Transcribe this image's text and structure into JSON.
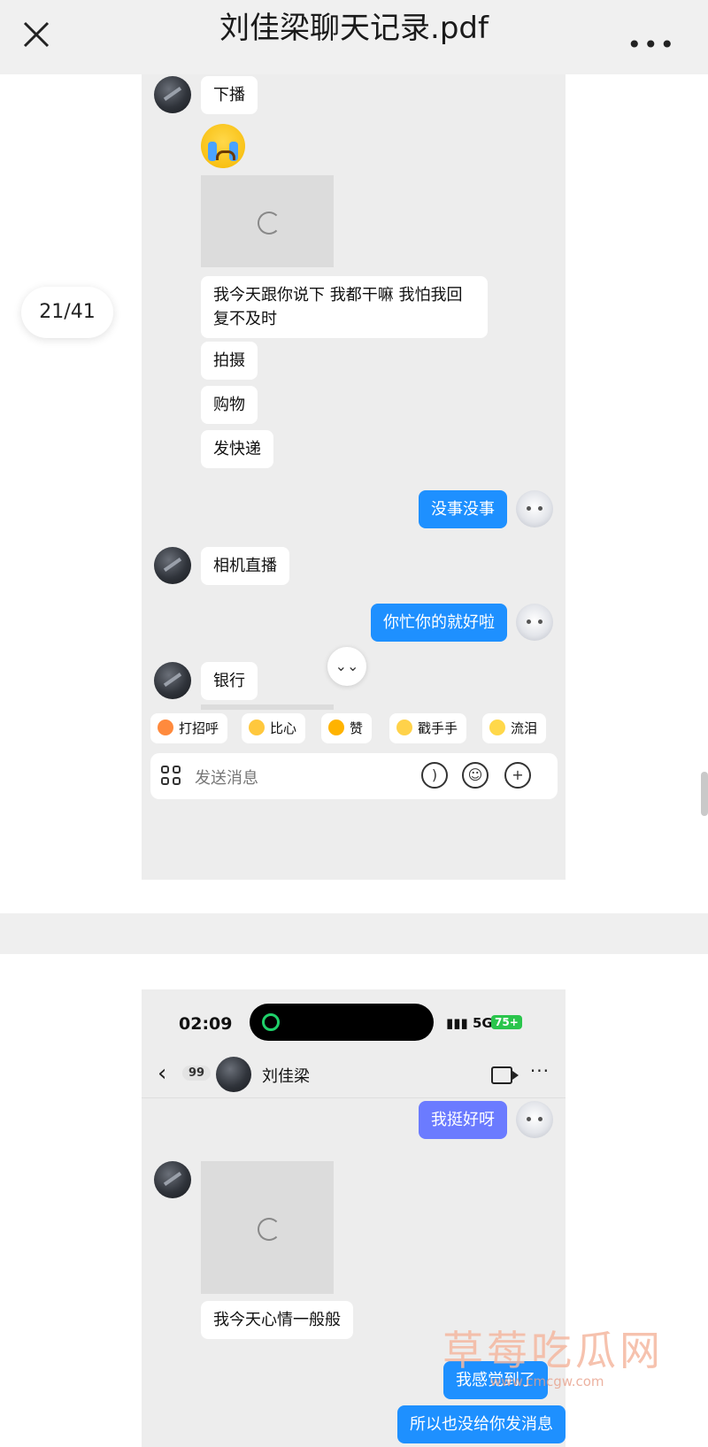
{
  "header": {
    "title": "刘佳梁聊天记录.pdf",
    "more": "•••"
  },
  "page_indicator": "21/41",
  "screenshot1": {
    "messages_left_top": [
      "下播"
    ],
    "long_message": "我今天跟你说下 我都干嘛 我怕我回复不及时",
    "list_messages": [
      "拍摄",
      "购物",
      "发快递"
    ],
    "reply1": "没事没事",
    "left2": "相机直播",
    "reply2": "你忙你的就好啦",
    "left3": "银行",
    "quick_replies": [
      "打招呼",
      "比心",
      "赞",
      "戳手手",
      "流泪"
    ],
    "input_placeholder": "发送消息"
  },
  "screenshot2": {
    "status": {
      "time": "02:09",
      "network": "5G",
      "battery": "75+"
    },
    "nav": {
      "unread": "99",
      "name": "刘佳梁"
    },
    "reply_top": "我挺好呀",
    "left_msg": "我今天心情一般般",
    "reply_a": "我感觉到了",
    "reply_b": "所以也没给你发消息"
  },
  "watermark": {
    "text": "草莓吃瓜网",
    "url": "www.cmcgw.com"
  }
}
